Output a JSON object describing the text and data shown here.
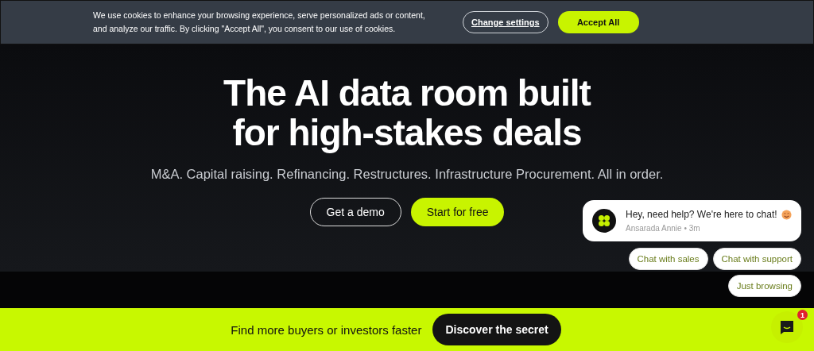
{
  "cookie_banner": {
    "text": "We use cookies to enhance your browsing experience, serve personalized ads or content, and analyze our traffic. By clicking \"Accept All\", you consent to our use of cookies.",
    "buttons": [
      {
        "label": "Change settings",
        "kind": "outline"
      },
      {
        "label": "Accept All",
        "kind": "primary"
      }
    ]
  },
  "hero": {
    "title": "The AI data room built for high-stakes deals",
    "subtitle": "M&A. Capital raising. Refinancing. Restructures. Infrastructure Procurement. All in order.",
    "buttons": [
      {
        "label": "Get a demo",
        "kind": "outline"
      },
      {
        "label": "Start for free",
        "kind": "primary"
      }
    ]
  },
  "chat": {
    "message": "Hey, need help? We're here to chat!",
    "sender": "Ansarada Annie • 3m",
    "options": [
      "Chat with sales",
      "Chat with support",
      "Just browsing"
    ],
    "badge": "1"
  },
  "promo_bar": {
    "text": "Find more buyers or investors faster",
    "button": "Discover the secret"
  }
}
